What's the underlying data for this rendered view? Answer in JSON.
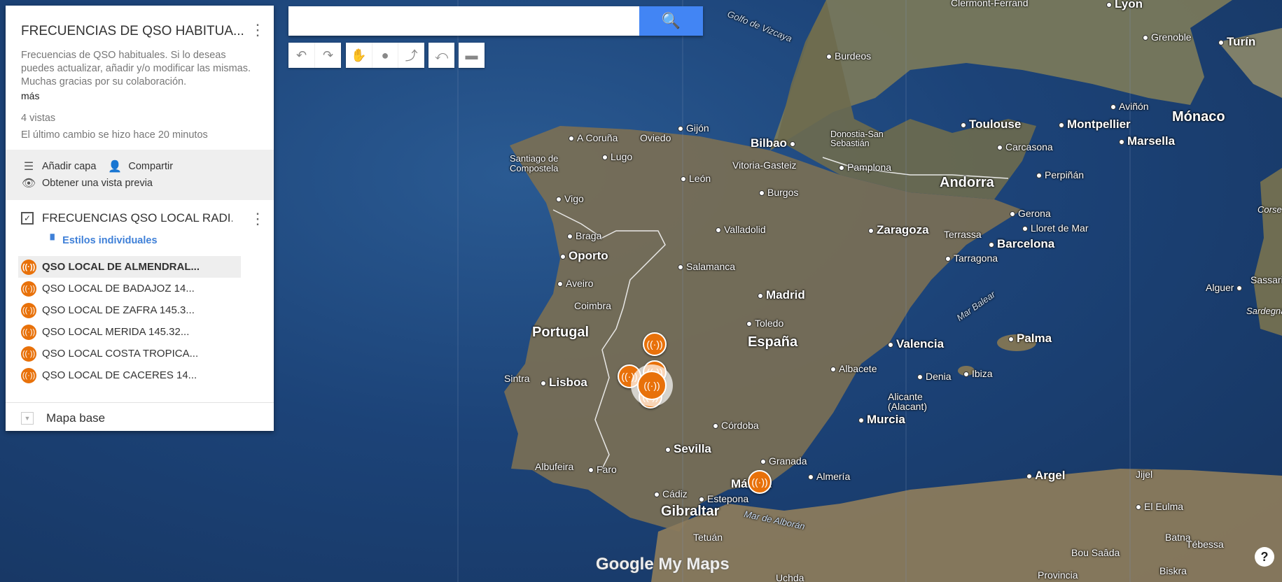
{
  "map": {
    "title": "FRECUENCIAS DE QSO HABITUA...",
    "description": "Frecuencias de QSO habituales. Si lo deseas puedes actualizar, añadir y/o modificar las mismas. Muchas gracias por su colaboración.",
    "more_label": "más",
    "views": "4 vistas",
    "last_change": "El último cambio se hizo hace 20 minutos"
  },
  "actions": {
    "add_layer": "Añadir capa",
    "share": "Compartir",
    "preview": "Obtener una vista previa"
  },
  "layer": {
    "title": "FRECUENCIAS QSO LOCAL RADI...",
    "styles_label": "Estilos individuales",
    "items": [
      "QSO LOCAL DE ALMENDRAL...",
      "QSO LOCAL DE BADAJOZ 14...",
      "QSO LOCAL DE ZAFRA 145.3...",
      "QSO LOCAL MERIDA 145.32...",
      "QSO LOCAL COSTA TROPICA...",
      "QSO LOCAL DE CACERES 14..."
    ]
  },
  "base_map_label": "Mapa base",
  "search": {
    "placeholder": ""
  },
  "logo": "Google My Maps",
  "help": "?",
  "places": {
    "portugal": "Portugal",
    "espana": "España",
    "andorra": "Andorra",
    "monaco": "Mónaco",
    "gibraltar": "Gibraltar",
    "madrid": "Madrid",
    "lisboa": "Lisboa",
    "oporto": "Oporto",
    "sevilla": "Sevilla",
    "valencia": "Valencia",
    "zaragoza": "Zaragoza",
    "barcelona": "Barcelona",
    "bilbao": "Bilbao",
    "murcia": "Murcia",
    "palma": "Palma",
    "argel": "Argel",
    "toulouse": "Toulouse",
    "montpellier": "Montpellier",
    "marsella": "Marsella",
    "turin": "Turín",
    "burdeos": "Burdeos",
    "coruna": "A Coruña",
    "santiago": "Santiago de Compostela",
    "lugo": "Lugo",
    "oviedo": "Oviedo",
    "gijon": "Gijón",
    "leon": "León",
    "vigo": "Vigo",
    "braga": "Braga",
    "aveiro": "Aveiro",
    "coimbra": "Coimbra",
    "sintra": "Sintra",
    "salamanca": "Salamanca",
    "valladolid": "Valladolid",
    "burgos": "Burgos",
    "vitoria": "Vitoria-Gasteiz",
    "pamplona": "Pamplona",
    "donostia": "Donostia-San Sebastián",
    "toledo": "Toledo",
    "albacete": "Albacete",
    "cordoba": "Córdoba",
    "granada": "Granada",
    "malaga": "Málaga",
    "almeria": "Almería",
    "alicante": "Alicante (Alacant)",
    "denia": "Denia",
    "ibiza": "Ibiza",
    "tarragona": "Tarragona",
    "terrassa": "Terrassa",
    "girona": "Gerona",
    "lloret": "Lloret de Mar",
    "perpinan": "Perpiñán",
    "carcasona": "Carcasona",
    "faro": "Faro",
    "albufeira": "Albufeira",
    "cadiz": "Cádiz",
    "estepona": "Estepona",
    "tetuan": "Tetuán",
    "grenoble": "Grenoble",
    "avinon": "Aviñón",
    "lyon": "Lyon",
    "clermont": "Clermont-Ferrand",
    "golfo": "Golfo de Vizcaya",
    "mar_balear": "Mar Balear",
    "mar_alboran": "Mar de Alborán",
    "alguer": "Alguer",
    "corse": "Corse",
    "sardegna": "Sardegna",
    "sassari": "Sassari",
    "jijel": "Jijel",
    "el_eulma": "El Eulma",
    "batna": "Batna",
    "bou_saada": "Bou Saâda",
    "tebessa": "Tébessa",
    "biskra": "Biskra",
    "uchda": "Uchda",
    "provincia": "Provincia"
  }
}
